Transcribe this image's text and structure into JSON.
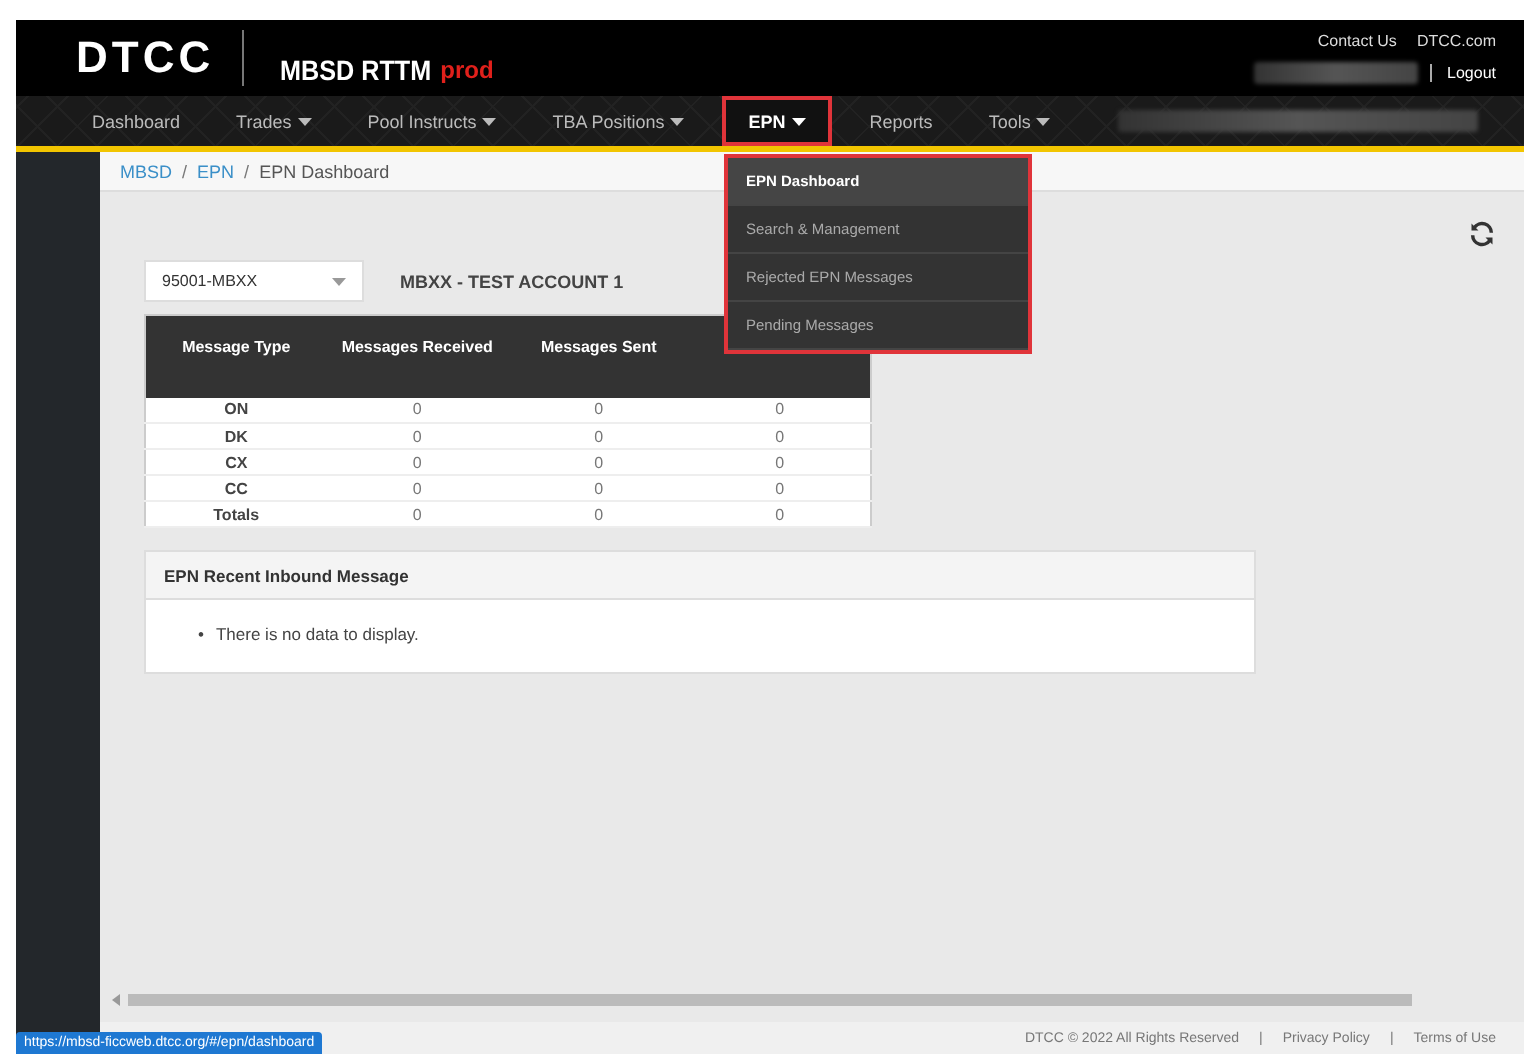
{
  "header": {
    "logo": "DTCC",
    "app_title": "MBSD RTTM",
    "environment": "prod",
    "top_links": [
      "Contact Us",
      "DTCC.com"
    ],
    "logout": "Logout"
  },
  "nav": [
    {
      "label": "Dashboard",
      "has_menu": false,
      "selected": false
    },
    {
      "label": "Trades",
      "has_menu": true,
      "selected": false
    },
    {
      "label": "Pool Instructs",
      "has_menu": true,
      "selected": false
    },
    {
      "label": "TBA Positions",
      "has_menu": true,
      "selected": false
    },
    {
      "label": "EPN",
      "has_menu": true,
      "selected": true
    },
    {
      "label": "Reports",
      "has_menu": false,
      "selected": false
    },
    {
      "label": "Tools",
      "has_menu": true,
      "selected": false
    }
  ],
  "epn_menu": [
    {
      "label": "EPN Dashboard",
      "selected": true
    },
    {
      "label": "Search & Management",
      "selected": false
    },
    {
      "label": "Rejected EPN Messages",
      "selected": false
    },
    {
      "label": "Pending Messages",
      "selected": false
    }
  ],
  "breadcrumb": [
    {
      "label": "MBSD",
      "link": true
    },
    {
      "separator": "/",
      "label": "EPN",
      "link": true
    },
    {
      "separator": "/",
      "label": "EPN Dashboard",
      "link": false
    }
  ],
  "account_select": {
    "value": "95001-MBXX"
  },
  "account_name": "MBXX - TEST ACCOUNT 1",
  "table": {
    "columns": [
      "Message Type",
      "Messages Received",
      "Messages Sent"
    ],
    "rows": [
      [
        "ON",
        "0",
        "0",
        "0"
      ],
      [
        "DK",
        "0",
        "0",
        "0"
      ],
      [
        "CX",
        "0",
        "0",
        "0"
      ],
      [
        "CC",
        "0",
        "0",
        "0"
      ],
      [
        "Totals",
        "0",
        "0",
        "0"
      ]
    ]
  },
  "inbound_panel": {
    "title": "EPN Recent Inbound Message",
    "items": [
      {
        "bullet": "•",
        "text": "There is no data to display."
      }
    ]
  },
  "footer": {
    "copyright": "DTCC © 2022 All Rights Reserved",
    "links": [
      {
        "separator": "|",
        "label": "Privacy Policy"
      },
      {
        "separator": "|",
        "label": "Terms of Use"
      }
    ]
  },
  "status_url": "https://mbsd-ficcweb.dtcc.org/#/epn/dashboard"
}
